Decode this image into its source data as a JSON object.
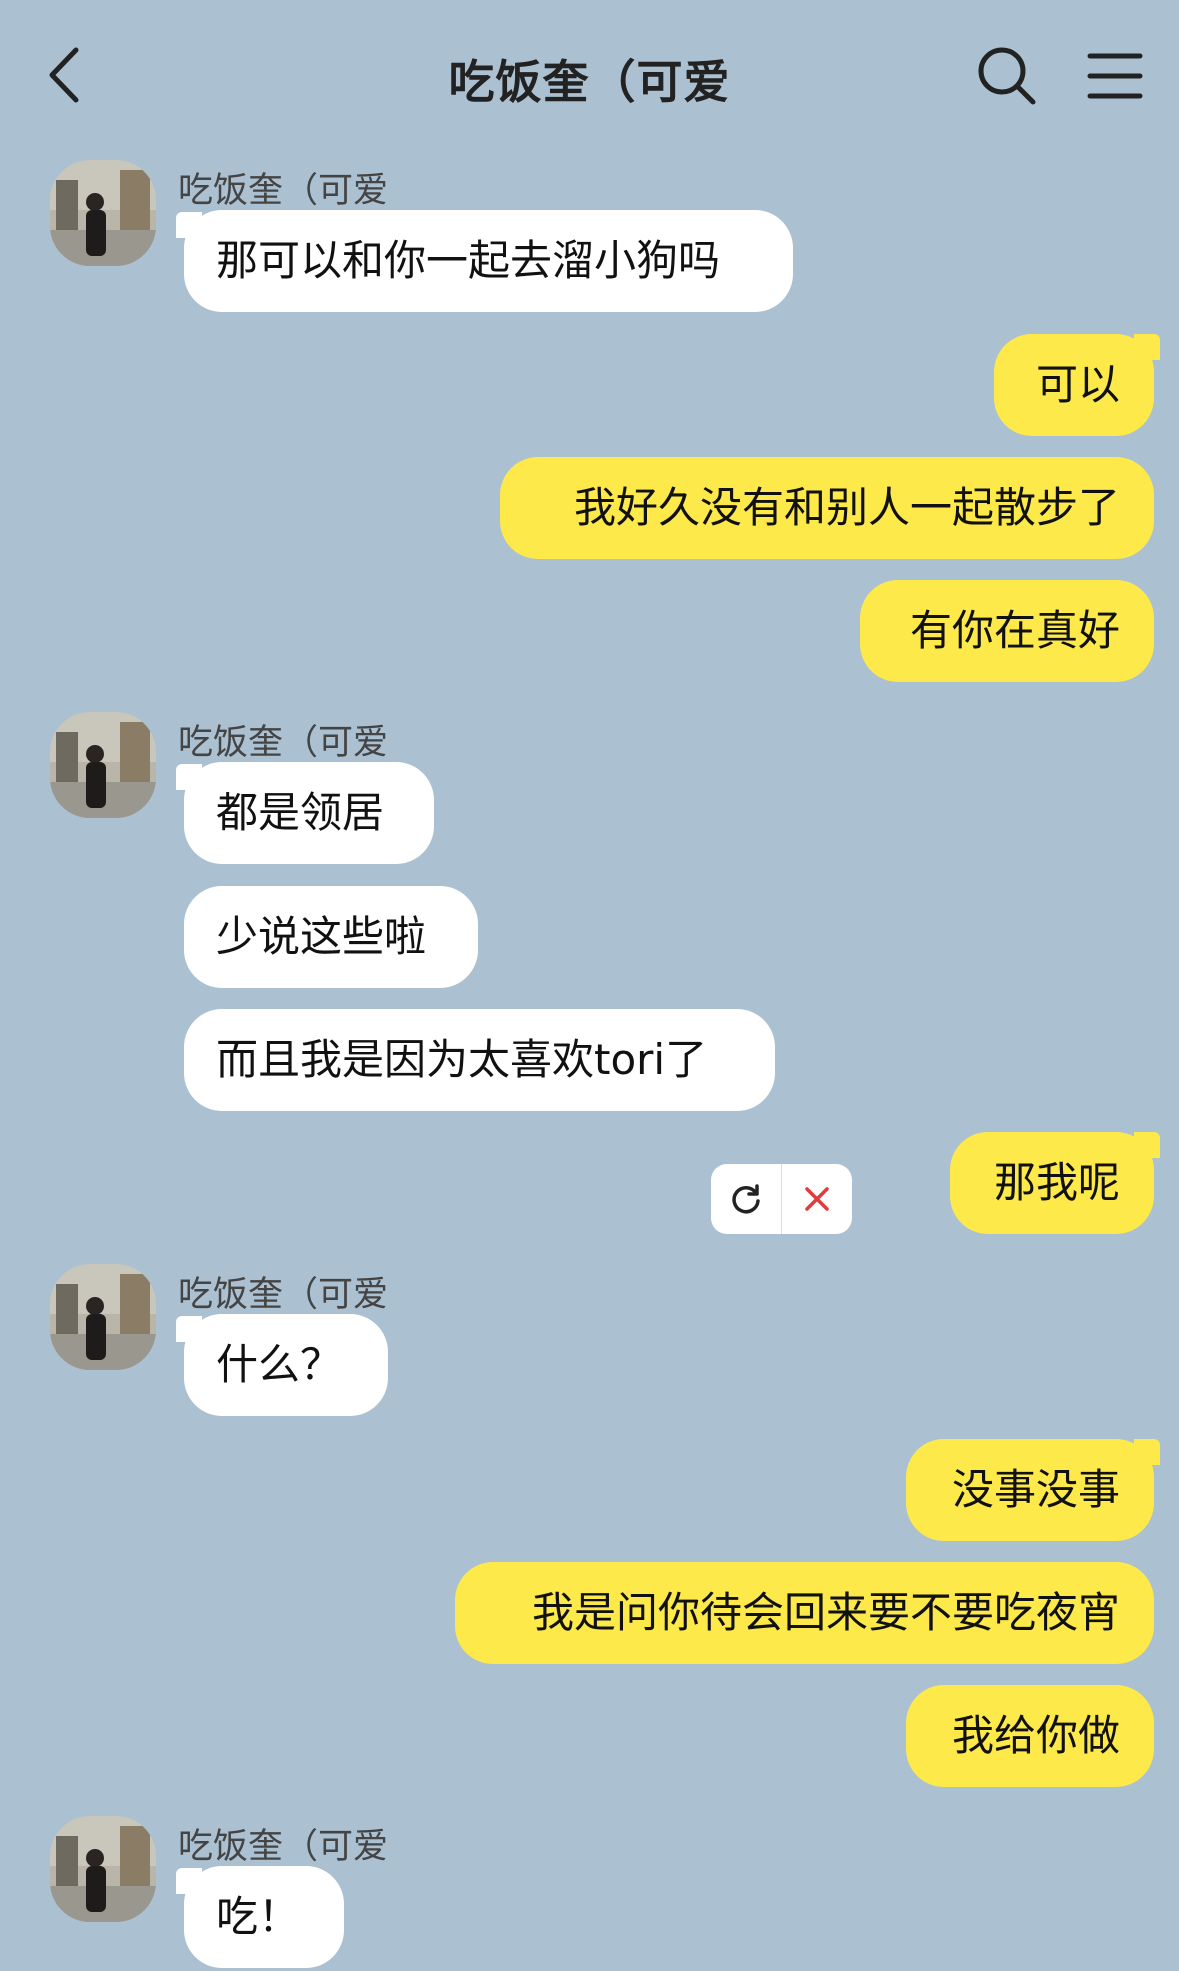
{
  "header": {
    "title": "吃饭奎（可爱",
    "back_icon": "chevron-left-icon",
    "search_icon": "search-icon",
    "menu_icon": "menu-icon"
  },
  "contact": {
    "name": "吃饭奎（可爱"
  },
  "messages": [
    {
      "side": "in",
      "text": "那可以和你一起去溜小狗吗"
    },
    {
      "side": "out",
      "text": "可以"
    },
    {
      "side": "out",
      "text": "我好久没有和别人一起散步了"
    },
    {
      "side": "out",
      "text": "有你在真好"
    },
    {
      "side": "in",
      "text": "都是领居"
    },
    {
      "side": "in",
      "text": "少说这些啦"
    },
    {
      "side": "in",
      "text": "而且我是因为太喜欢tori了"
    },
    {
      "side": "out",
      "text": "那我呢",
      "failed": true
    },
    {
      "side": "in",
      "text": "什么？"
    },
    {
      "side": "out",
      "text": "没事没事"
    },
    {
      "side": "out",
      "text": "我是问你待会回来要不要吃夜宵"
    },
    {
      "side": "out",
      "text": "我给你做"
    },
    {
      "side": "in",
      "text": "吃！"
    }
  ],
  "colors": {
    "background": "#abc1d1",
    "outgoing": "#fde94a",
    "incoming": "#ffffff",
    "error": "#e23b3b"
  }
}
